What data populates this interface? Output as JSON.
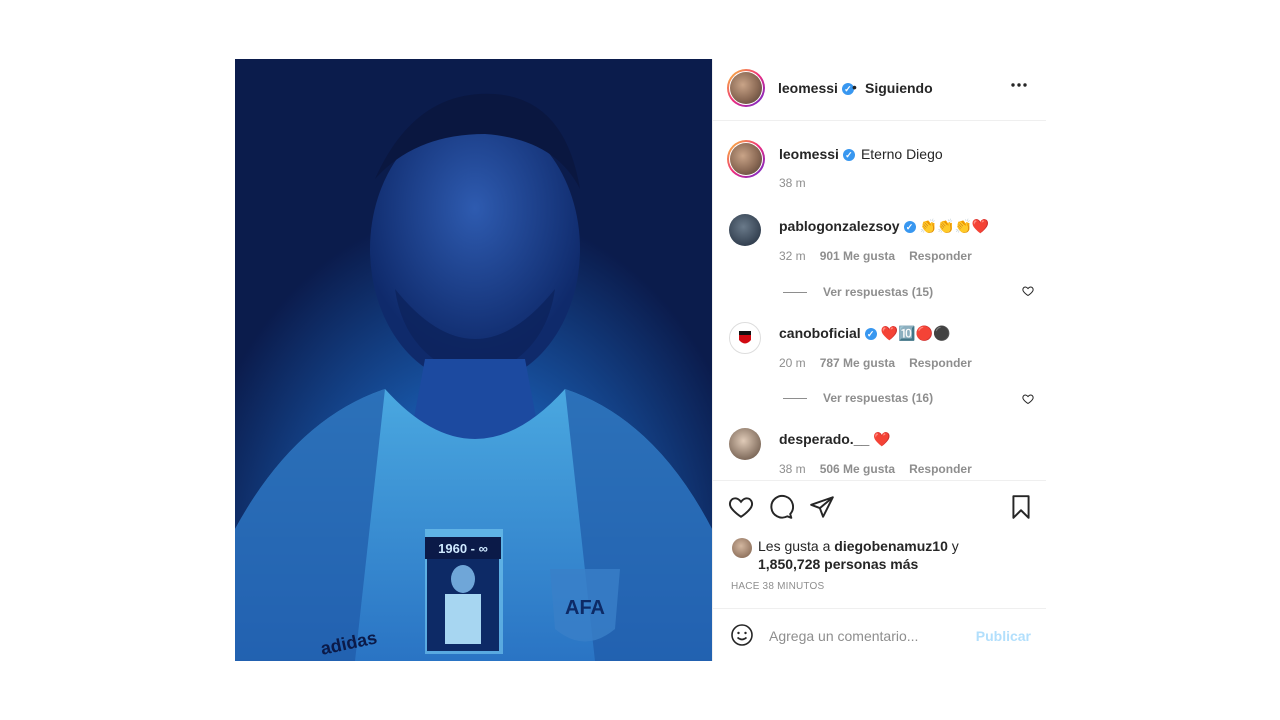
{
  "post": {
    "author": "leomessi",
    "follow_status": "Siguiendo",
    "dot": "•",
    "more": "•••",
    "caption": "Eterno Diego",
    "caption_time": "38 m",
    "image": {
      "shirt_text": "1960 - ∞",
      "brand_text": "adidas",
      "crest_text": "AFA"
    }
  },
  "comments": [
    {
      "user": "pablogonzalezsoy",
      "verified": true,
      "text": "👏👏👏❤️",
      "time": "32 m",
      "likes": "901 Me gusta",
      "reply": "Responder",
      "replies": "Ver respuestas (15)"
    },
    {
      "user": "canoboficial",
      "verified": true,
      "text": "❤️🔟🔴⚫",
      "time": "20 m",
      "likes": "787 Me gusta",
      "reply": "Responder",
      "replies": "Ver respuestas (16)"
    },
    {
      "user": "desperado.__",
      "verified": false,
      "text": "❤️",
      "time": "38 m",
      "likes": "506 Me gusta",
      "reply": "Responder"
    }
  ],
  "likes": {
    "prefix": "Les gusta a ",
    "user": "diegobenamuz10",
    "and": " y",
    "count": "1,850,728 personas más"
  },
  "time_ago": "HACE 38 MINUTOS",
  "add_comment": {
    "placeholder": "Agrega un comentario...",
    "publish": "Publicar"
  },
  "colors": {
    "verified": "#3897f0",
    "publish_disabled": "#b2dffc",
    "muted": "#8e8e8e"
  }
}
